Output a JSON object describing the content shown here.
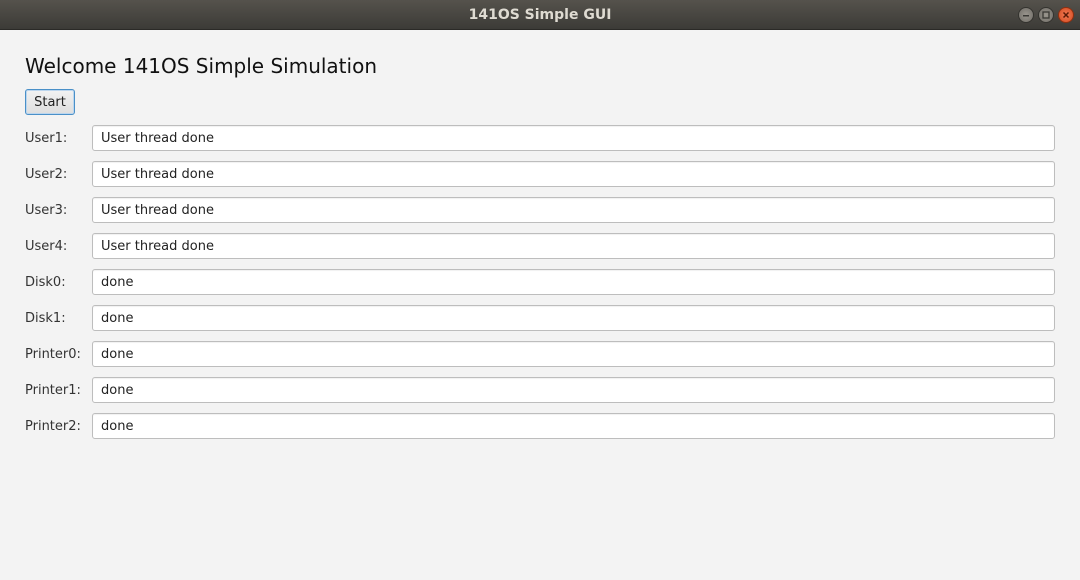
{
  "window": {
    "title": "141OS Simple GUI"
  },
  "main": {
    "heading": "Welcome 141OS Simple Simulation",
    "start_label": "Start",
    "rows": [
      {
        "label": "User1:",
        "value": "User thread done"
      },
      {
        "label": "User2:",
        "value": "User thread done"
      },
      {
        "label": "User3:",
        "value": "User thread done"
      },
      {
        "label": "User4:",
        "value": "User thread done"
      },
      {
        "label": "Disk0:",
        "value": "done"
      },
      {
        "label": "Disk1:",
        "value": "done"
      },
      {
        "label": "Printer0:",
        "value": "done"
      },
      {
        "label": "Printer1:",
        "value": "done"
      },
      {
        "label": "Printer2:",
        "value": "done"
      }
    ]
  },
  "icons": {
    "minimize": "minimize-icon",
    "maximize": "maximize-icon",
    "close": "close-icon"
  },
  "colors": {
    "titlebar": "#3c3b37",
    "close_button": "#e9541f",
    "focus_accent": "#4a90c8",
    "background": "#f3f3f3"
  }
}
